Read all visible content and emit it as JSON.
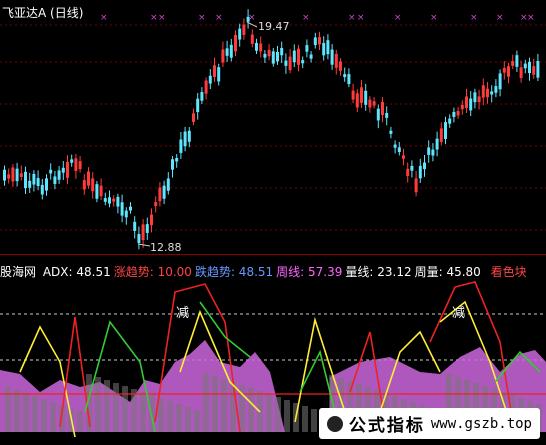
{
  "window": {
    "title": "飞亚达A (日线)"
  },
  "price_chart": {
    "high_label": "19.47",
    "low_label": "12.88"
  },
  "indicator": {
    "name": "股海网",
    "items": [
      {
        "label": "ADX:",
        "value": "48.51",
        "color": "#ffffff"
      },
      {
        "label": "涨趋势:",
        "value": "10.00",
        "color": "#ff4444"
      },
      {
        "label": "跌趋势:",
        "value": "48.51",
        "color": "#6699ff"
      },
      {
        "label": "周线:",
        "value": "57.39",
        "color": "#ff66ff"
      },
      {
        "label": "量线:",
        "value": "23.12",
        "color": "#ffffff"
      },
      {
        "label": "周量:",
        "value": "45.80",
        "color": "#ffffff"
      }
    ],
    "tail": "看色块",
    "tail_color": "#ff4444",
    "annotations": [
      "减",
      "减"
    ]
  },
  "watermark": {
    "text": "公式指标",
    "url": "www.gszb.top"
  },
  "colors": {
    "up": "#ff3b3b",
    "down": "#5ee6ff",
    "grid": "#7a0000",
    "mark": "#cc44cc",
    "area": "#cc66dd",
    "yellow": "#ffee33",
    "green": "#33cc33",
    "red": "#ee2222"
  }
}
